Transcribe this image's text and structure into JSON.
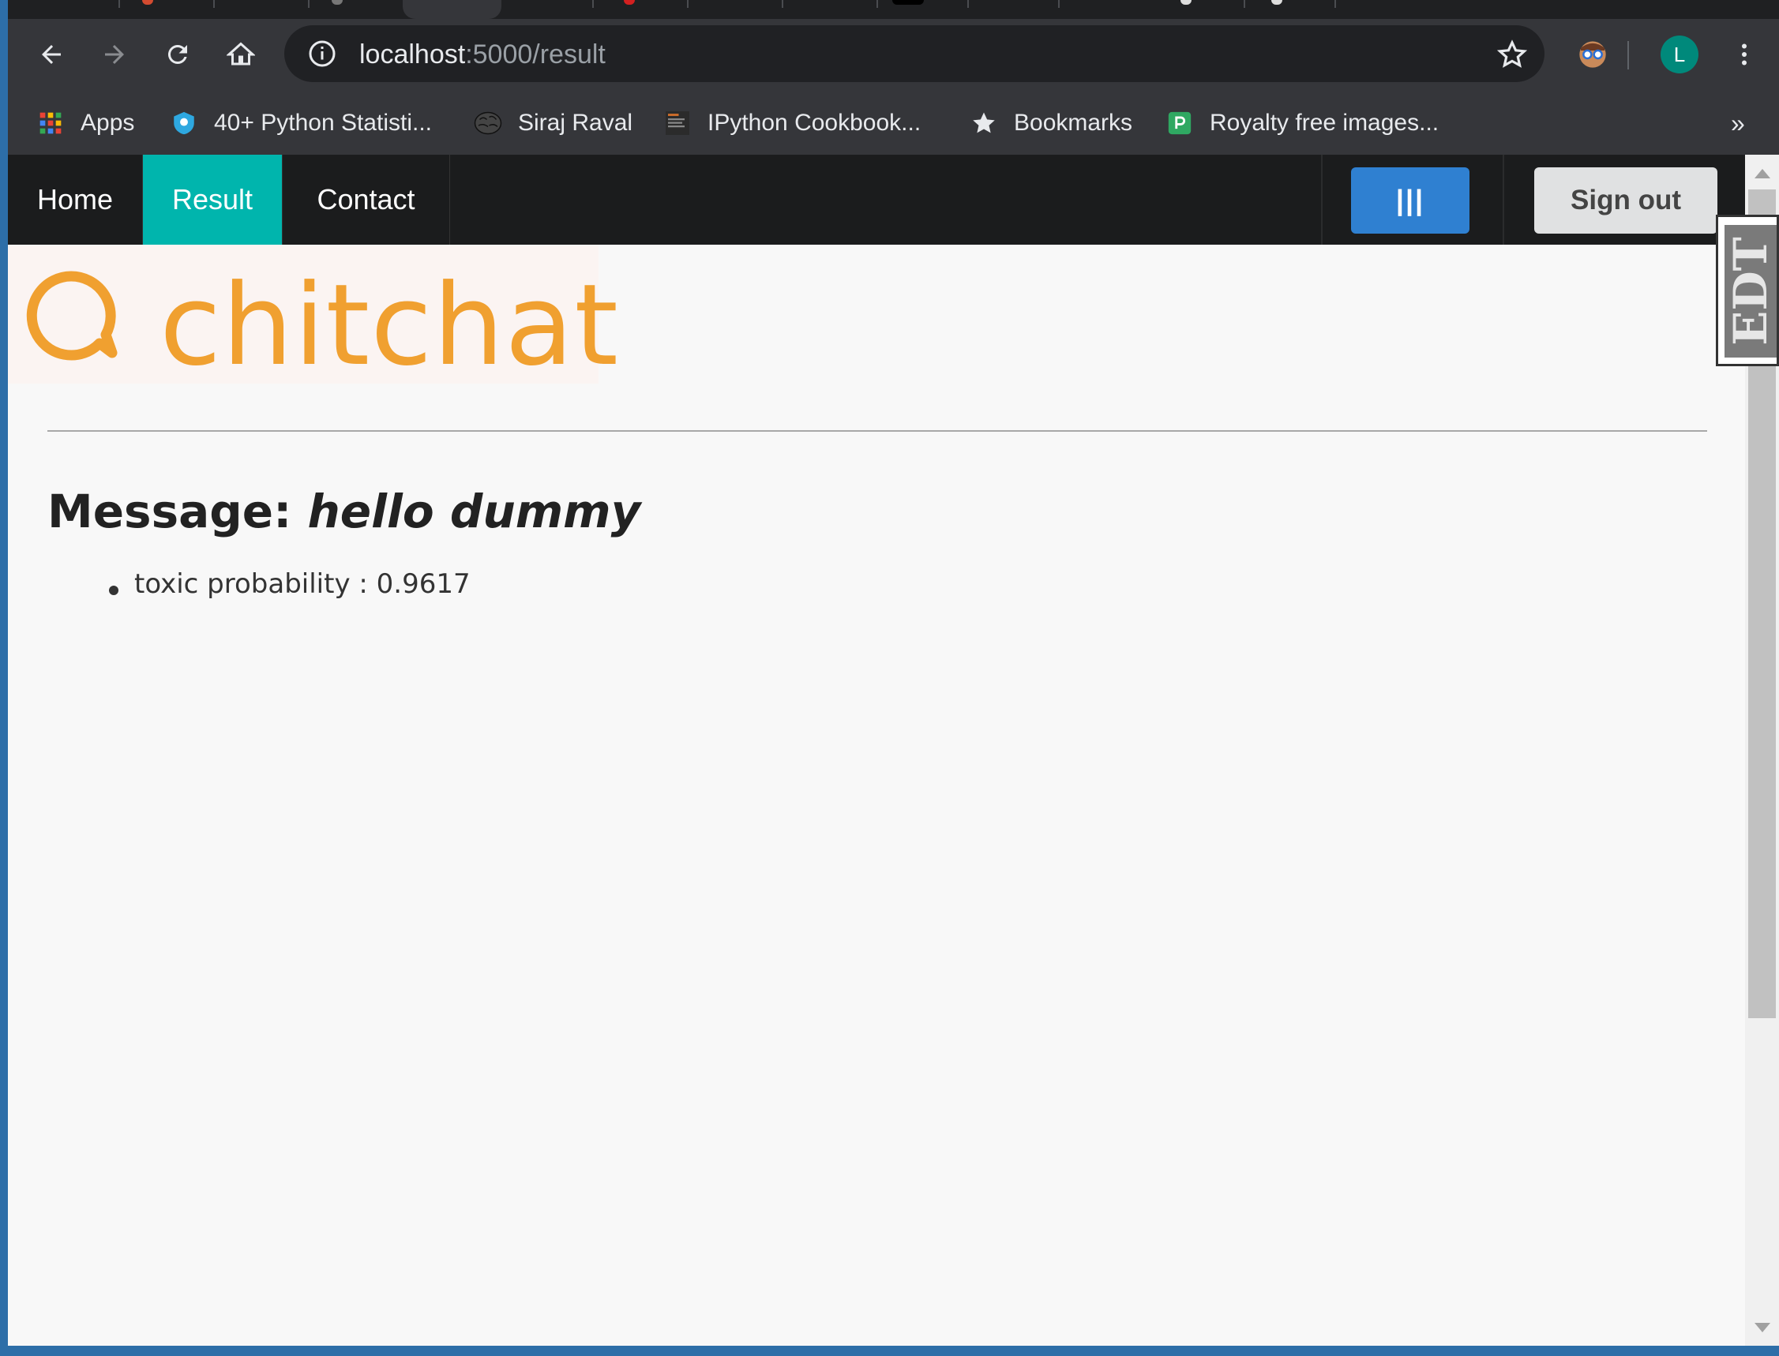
{
  "browser": {
    "url_host": "localhost",
    "url_path": ":5000/result",
    "profile_initial": "L",
    "bookmarks": [
      {
        "label": "Apps",
        "icon": "apps-grid-icon"
      },
      {
        "label": "40+ Python Statisti...",
        "icon": "shield-icon"
      },
      {
        "label": "Siraj Raval",
        "icon": "brain-icon"
      },
      {
        "label": "IPython Cookbook...",
        "icon": "book-thumbnail-icon"
      },
      {
        "label": "Bookmarks",
        "icon": "star-icon"
      },
      {
        "label": "Royalty free images...",
        "icon": "pixabay-icon"
      }
    ],
    "overflow_label": "»"
  },
  "nav": {
    "items": [
      {
        "label": "Home"
      },
      {
        "label": "Result"
      },
      {
        "label": "Contact"
      }
    ],
    "menu_button_label": "|||",
    "signout_label": "Sign out"
  },
  "logo": {
    "text": "chitchat",
    "color": "#f0a030"
  },
  "result": {
    "message_label": "Message:",
    "message_text": "hello dummy",
    "items": [
      {
        "text": "toxic probability : 0.9617"
      }
    ]
  },
  "edt_widget": {
    "text": "EDT"
  },
  "colors": {
    "nav_active": "#00b5ad",
    "menu_button": "#2f80d1",
    "signout_button": "#e0e1e2",
    "logo": "#f0a030"
  }
}
